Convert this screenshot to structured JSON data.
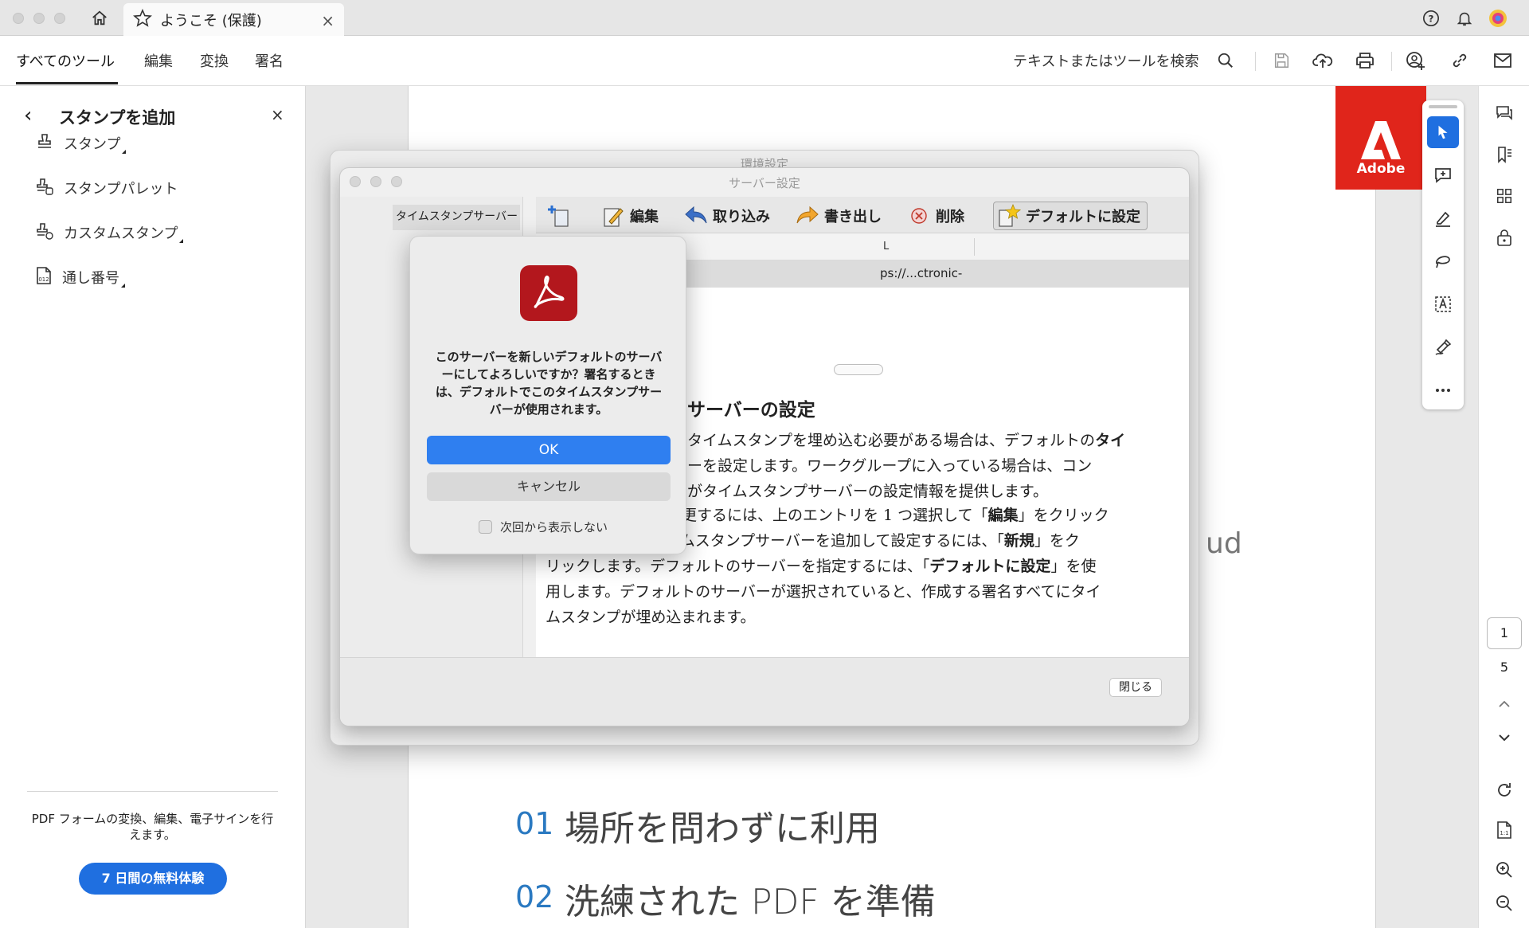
{
  "tab": {
    "title": "ようこそ (保護)",
    "close": "×"
  },
  "menu": {
    "all_tools": "すべてのツール",
    "edit": "編集",
    "convert": "変換",
    "sign": "署名"
  },
  "search": {
    "label": "テキストまたはツールを検索"
  },
  "left_panel": {
    "back": "‹",
    "title": "スタンプを追加",
    "close": "×",
    "items": [
      {
        "label": "スタンプ",
        "icon": "stamp-icon"
      },
      {
        "label": "スタンプパレット",
        "icon": "stamp-palette-icon"
      },
      {
        "label": "カスタムスタンプ",
        "icon": "custom-stamp-icon"
      },
      {
        "label": "通し番号",
        "icon": "numbering-icon"
      }
    ],
    "promo_text": "PDF フォームの変換、編集、電子サインを行えます。",
    "trial_button": "7 日間の無料体験"
  },
  "document": {
    "logo_text": "Adobe",
    "items": [
      {
        "num": "01",
        "text": "場所を問わずに利用"
      },
      {
        "num": "02",
        "text": "洗練された PDF を準備"
      }
    ],
    "fragment": "ud"
  },
  "prefs_window": {
    "title": "環境設定"
  },
  "server_window": {
    "title": "サーバー設定",
    "sidebar_item": "タイムスタンプサーバー",
    "toolbar": {
      "edit": "編集",
      "import": "取り込み",
      "export": "書き出し",
      "delete": "削除",
      "set_default": "デフォルトに設定"
    },
    "list_header": "L",
    "row_url": "ps://...ctronic-",
    "heading": "サーバーの設定",
    "para1_a": "タイムスタンプを埋め込む必要がある場合は、デフォルトの",
    "para1_b": "タイ",
    "para1_c": "ーを設定します。ワークグループに入っている場合は、コン",
    "para1_d": "がタイムスタンプサーバーの設定情報を提供します。",
    "para2_l1a": "設定を表示または変更するには、上のエントリを 1 つ選択して「",
    "para2_l1b": "編集",
    "para2_l1c": "」をクリック",
    "para2_l2a": "します。新しいタイムスタンプサーバーを追加して設定するには、「",
    "para2_l2b": "新規",
    "para2_l2c": "」をク",
    "para2_l3a": "リックします。デフォルトのサーバーを指定するには、「",
    "para2_l3b": "デフォルトに設定",
    "para2_l3c": "」を使",
    "para2_l4": "用します。デフォルトのサーバーが選択されていると、作成する署名すべてにタイ",
    "para2_l5": "ムスタンプが埋め込まれます。",
    "close_button": "閉じる"
  },
  "alert": {
    "message": "このサーバーを新しいデフォルトのサーバーにしてよろしいですか？署名するときは、デフォルトでこのタイムスタンプサーバーが使用されます。",
    "ok": "OK",
    "cancel": "キャンセル",
    "dont_show": "次回から表示しない"
  },
  "page_nav": {
    "current": "1",
    "total": "5"
  },
  "colors": {
    "accent": "#1f6fe0",
    "adobe_red": "#e0251b",
    "acrobat_icon": "#b3171d"
  }
}
